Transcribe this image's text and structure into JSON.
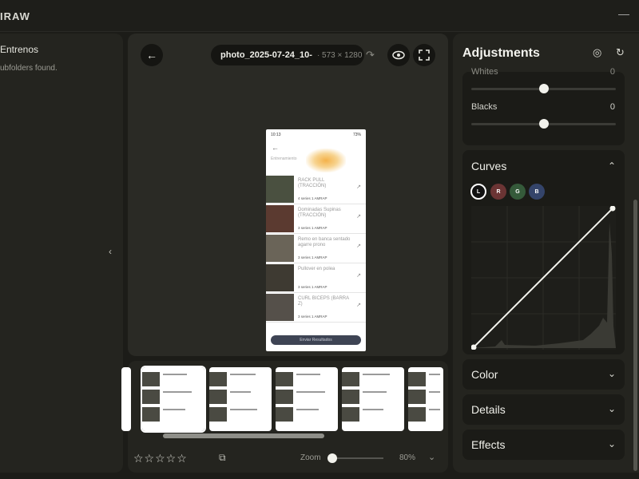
{
  "app": {
    "title": "IRAW",
    "minimize": "—"
  },
  "left": {
    "folder": "Entrenos",
    "subtitle": "ubfolders found.",
    "collapse": "‹"
  },
  "viewer": {
    "back": "←",
    "file_name": "photo_2025-07-24_10-",
    "file_dims": "· 573 × 1280",
    "redo": "↷",
    "eye": "◉",
    "fullscreen": "⛶"
  },
  "phone": {
    "status_time": "10:13",
    "status_right": "73%",
    "back": "←",
    "header": "Entrenamiento",
    "exercises": [
      {
        "name": "RACK PULL (TRACCIÓN)",
        "meta": "4 series 1 AMRAP"
      },
      {
        "name": "Dominadas Supinas (TRACCIÓN)",
        "meta": "3 series 1 AMRAP"
      },
      {
        "name": "Remo en banca sentado agarre prono",
        "meta": "3 series 1 AMRAP"
      },
      {
        "name": "Pullover en polea",
        "meta": "3 series 1 AMRAP"
      },
      {
        "name": "CURL BICEPS (BARRA Z)",
        "meta": "3 series 1 AMRAP"
      }
    ],
    "button": "Enviar Resultados"
  },
  "filmstrip": {
    "stars": "☆☆☆☆☆",
    "copy": "⧉",
    "zoom_label": "Zoom",
    "zoom_value": "80%",
    "zoom_chevron": "⌄"
  },
  "adjustments": {
    "title": "Adjustments",
    "aperture": "◎",
    "reset": "↻",
    "whites_label": "Whites",
    "whites_value": "0",
    "blacks_label": "Blacks",
    "blacks_value": "0",
    "curves_title": "Curves",
    "curves_chevron": "⌃",
    "channels": [
      "L",
      "R",
      "G",
      "B"
    ],
    "color_title": "Color",
    "details_title": "Details",
    "effects_title": "Effects",
    "chevron_down": "⌄"
  }
}
